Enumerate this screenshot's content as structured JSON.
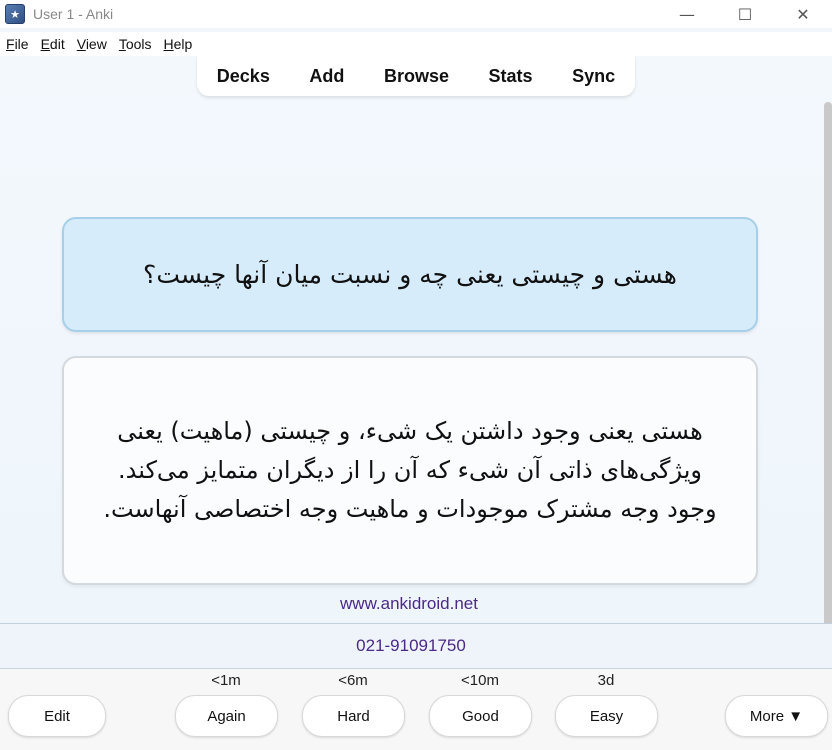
{
  "window": {
    "title": "User 1 - Anki",
    "controls": {
      "minimize": "—",
      "maximize": "☐",
      "close": "✕"
    }
  },
  "menu": {
    "file": {
      "u": "F",
      "rest": "ile"
    },
    "edit": {
      "u": "E",
      "rest": "dit"
    },
    "view": {
      "u": "V",
      "rest": "iew"
    },
    "tools": {
      "u": "T",
      "rest": "ools"
    },
    "help": {
      "u": "H",
      "rest": "elp"
    }
  },
  "toolbar": {
    "decks": "Decks",
    "add": "Add",
    "browse": "Browse",
    "stats": "Stats",
    "sync": "Sync"
  },
  "card": {
    "question": "هستی و چیستی یعنی چه و نسبت میان آنها چیست؟",
    "answer": "هستی یعنی وجود داشتن یک شیء، و چیستی (ماهیت) یعنی ویژگی‌های ذاتی آن شیء که آن را از دیگران متمایز می‌کند. وجود وجه مشترک موجودات و ماهیت وجه اختصاصی آنهاست."
  },
  "footer": {
    "website": "www.ankidroid.net",
    "phone": "021-91091750"
  },
  "review": {
    "edit_label": "Edit",
    "more_label": "More ▼",
    "answers": [
      {
        "label": "Again",
        "interval": "<1m"
      },
      {
        "label": "Hard",
        "interval": "<6m"
      },
      {
        "label": "Good",
        "interval": "<10m"
      },
      {
        "label": "Easy",
        "interval": "3d"
      }
    ]
  },
  "colors": {
    "question_bg": "#d7ecfb",
    "link_purple": "#4b2a86"
  },
  "icons": [
    "anki-app-icon",
    "minimize-icon",
    "maximize-icon",
    "close-icon"
  ]
}
